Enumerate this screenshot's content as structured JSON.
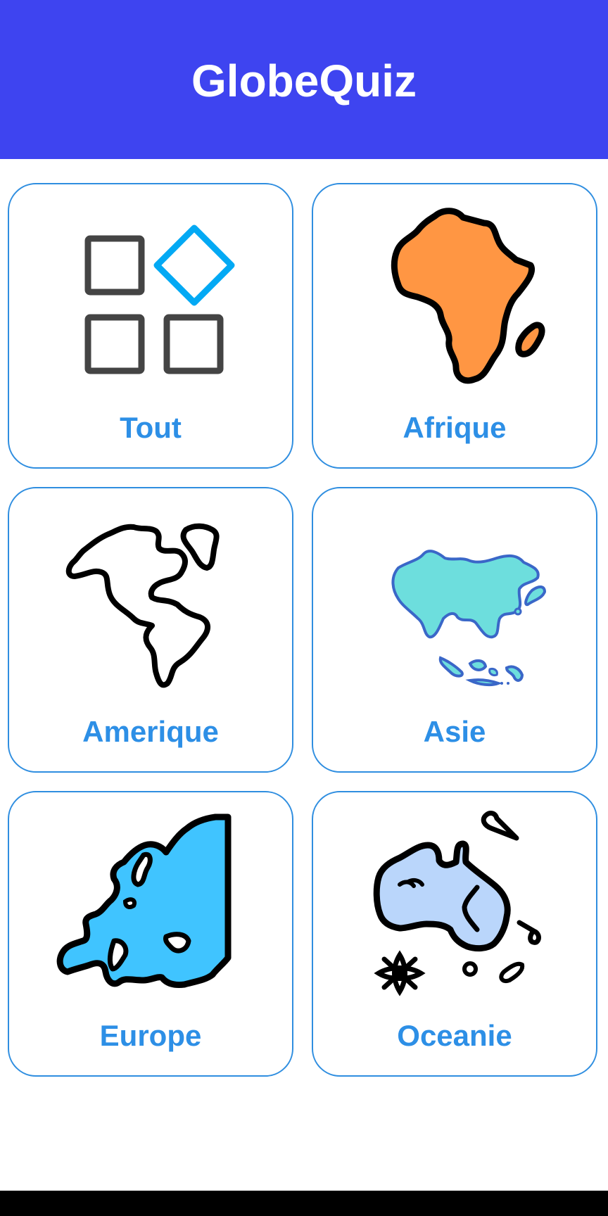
{
  "app_bar": {
    "title": "GlobeQuiz",
    "color": "#3e44f0"
  },
  "categories": [
    {
      "label": "Tout",
      "icon": "grid-icon"
    },
    {
      "label": "Afrique",
      "icon": "africa-map-icon"
    },
    {
      "label": "Amerique",
      "icon": "america-map-icon"
    },
    {
      "label": "Asie",
      "icon": "asia-map-icon"
    },
    {
      "label": "Europe",
      "icon": "europe-map-icon"
    },
    {
      "label": "Oceanie",
      "icon": "oceania-map-icon"
    }
  ],
  "colors": {
    "card_border": "#2f8ee0",
    "label": "#2d8fe6",
    "africa": "#ff9643",
    "asia": "#6ddedd",
    "asia_outline": "#3a67c8",
    "europe": "#40c4ff",
    "oceania": "#bad6fb",
    "grid_square": "#444444",
    "grid_diamond": "#03a9f4"
  }
}
